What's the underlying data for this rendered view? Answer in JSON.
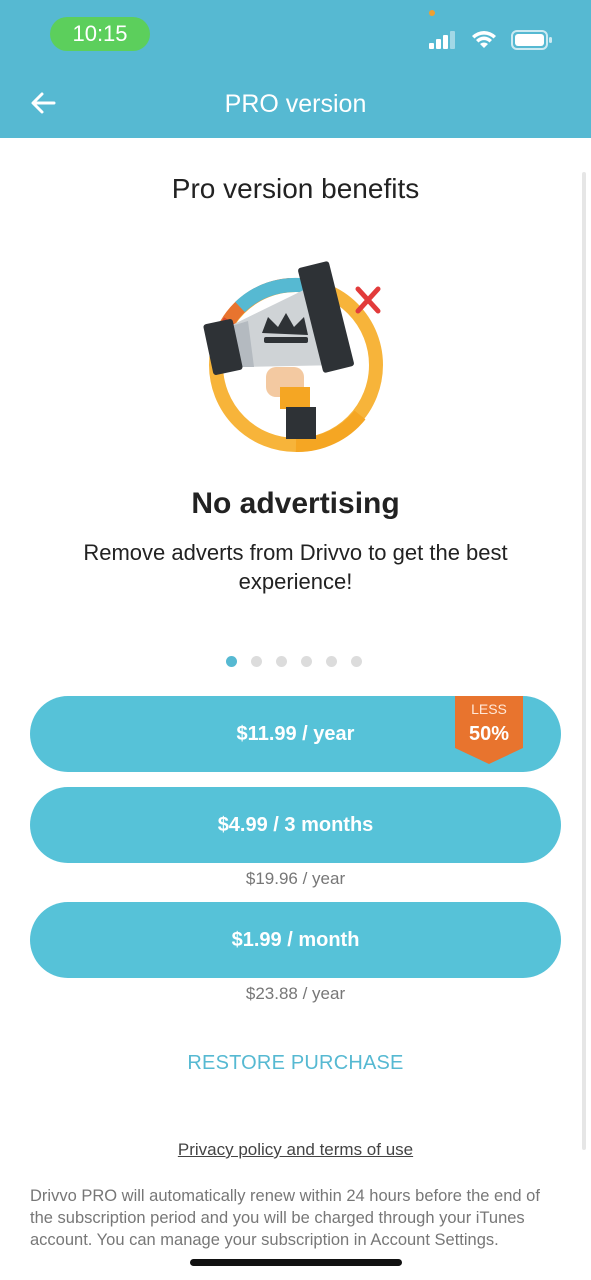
{
  "status_bar": {
    "time": "10:15"
  },
  "header": {
    "title": "PRO version",
    "back_icon": "arrow-left-icon"
  },
  "benefits": {
    "title": "Pro version benefits",
    "feature_title": "No advertising",
    "feature_description": "Remove adverts from Drivvo to get the best experience!",
    "illustration_icon": "megaphone-crown-icon",
    "pager": {
      "total": 6,
      "active_index": 0
    }
  },
  "plans": [
    {
      "label": "$11.99 / year",
      "badge_small": "LESS",
      "badge_big": "50%"
    },
    {
      "label": "$4.99 / 3 months",
      "yearly_equivalent": "$19.96 / year"
    },
    {
      "label": "$1.99 / month",
      "yearly_equivalent": "$23.88 / year"
    }
  ],
  "restore_label": "RESTORE PURCHASE",
  "privacy_link": "Privacy policy and terms of use",
  "disclaimer": "Drivvo PRO will automatically renew within 24 hours before the end of the subscription period and you will be charged through your iTunes account. You can manage your subscription in Account Settings.",
  "colors": {
    "header": "#56b9d2",
    "button": "#56c2d8",
    "badge": "#e8742e",
    "time_pill": "#5ccf5c"
  }
}
